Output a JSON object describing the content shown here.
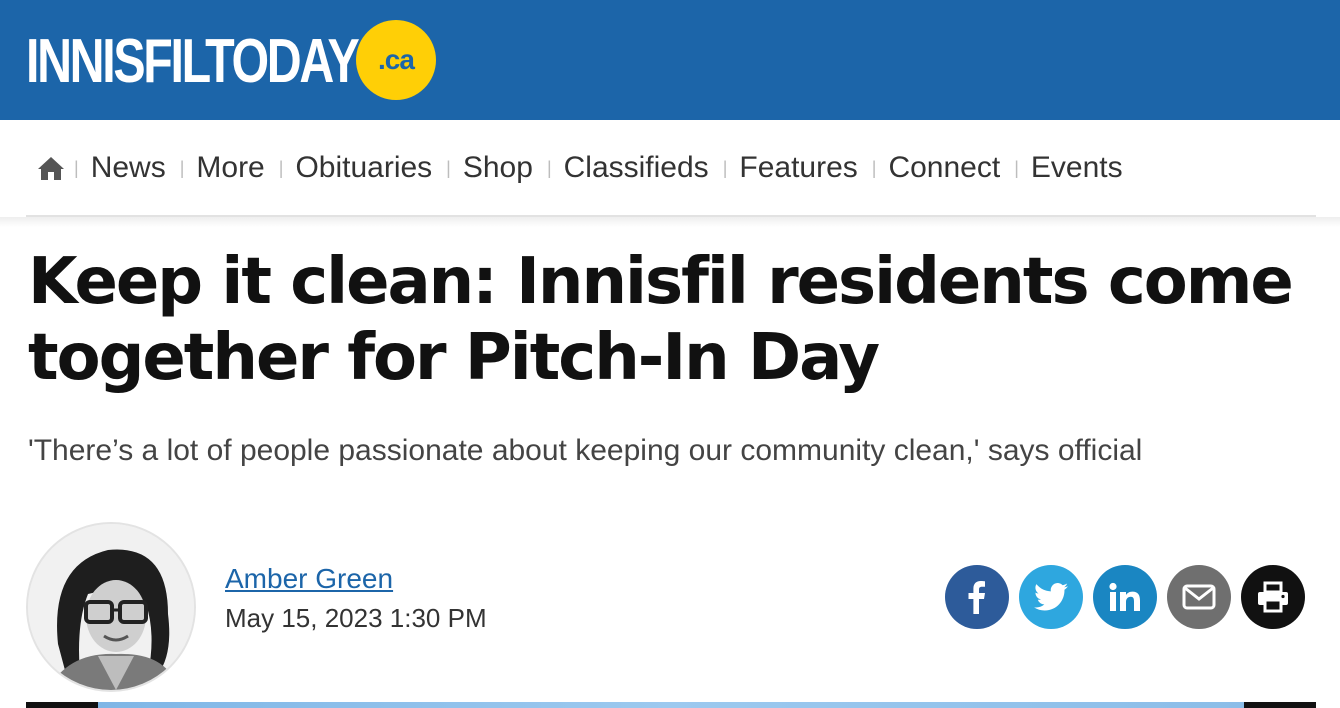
{
  "site": {
    "logo_text": "INNISFILTODAY",
    "logo_badge": ".ca",
    "brand_color": "#1c65a9",
    "badge_color": "#ffcf06"
  },
  "nav": {
    "home_icon": "home-icon",
    "items": [
      "News",
      "More",
      "Obituaries",
      "Shop",
      "Classifieds",
      "Features",
      "Connect",
      "Events"
    ]
  },
  "article": {
    "headline": "Keep it clean: Innisfil residents come together for Pitch-In Day",
    "subhead": "'There’s a lot of people passionate about keeping our community clean,' says official",
    "author": "Amber Green",
    "date": "May 15, 2023 1:30 PM"
  },
  "share": [
    {
      "name": "facebook",
      "color": "#2d5b9a",
      "icon": "facebook-icon"
    },
    {
      "name": "twitter",
      "color": "#2ea7df",
      "icon": "twitter-icon"
    },
    {
      "name": "linkedin",
      "color": "#1a86c2",
      "icon": "linkedin-icon"
    },
    {
      "name": "email",
      "color": "#6f6f6f",
      "icon": "email-icon"
    },
    {
      "name": "print",
      "color": "#111111",
      "icon": "print-icon"
    }
  ]
}
